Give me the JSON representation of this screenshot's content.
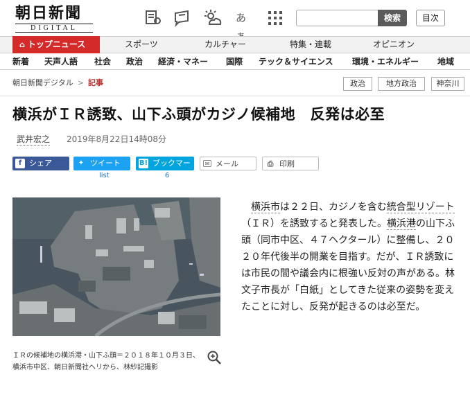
{
  "header": {
    "logo_main": "朝日新聞",
    "logo_sub": "DIGITAL",
    "language_toggle": "あぁ",
    "search_button": "検索",
    "search_placeholder": "",
    "toc_button": "目次"
  },
  "nav_primary": [
    "トップニュース",
    "スポーツ",
    "カルチャー",
    "特集・連載",
    "オピニオン"
  ],
  "nav_secondary": [
    "新着",
    "天声人語",
    "社会",
    "政治",
    "経済・マネー",
    "国際",
    "テック＆サイエンス",
    "環境・エネルギー",
    "地域"
  ],
  "breadcrumb": {
    "home": "朝日新聞デジタル",
    "separator": ">",
    "current": "記事"
  },
  "tags": [
    "政治",
    "地方政治",
    "神奈川"
  ],
  "article": {
    "title": "横浜がＩＲ誘致、山下ふ頭がカジノ候補地　反発は必至",
    "author": "武井宏之",
    "date": "2019年8月22日14時08分",
    "body_parts": [
      {
        "t": "　",
        "link": false
      },
      {
        "t": "横浜市",
        "link": true
      },
      {
        "t": "は２２日、カジノを含む",
        "link": false
      },
      {
        "t": "統合型リゾート",
        "link": true
      },
      {
        "t": "（ＩＲ）を誘致すると発表した。",
        "link": false
      },
      {
        "t": "横浜港",
        "link": true
      },
      {
        "t": "の山下ふ頭（同市中区、４７ヘクタール）に整備し、２０２０年代後半の開業を目指す。だが、ＩＲ誘致には市民の間や議会内に根強い反対の声がある。林文子市長が「白紙」としてきた従来の姿勢を変えたことに対し、反発が起きるのは必至だ。",
        "link": false
      }
    ],
    "photo_caption": "ＩＲの候補地の横浜港・山下ふ頭＝２０１８年１０月３日、横浜市中区、朝日新聞社ヘリから、林紗記撮影"
  },
  "share": {
    "facebook": "シェア",
    "twitter": "ツイート",
    "twitter_count": "list",
    "hatena": "ブックマーク",
    "hatena_count": "6",
    "mail": "メール",
    "print": "印刷"
  },
  "colors": {
    "brand_red": "#d42a2a",
    "facebook": "#3b5998",
    "twitter": "#1da1f2",
    "hatena": "#00a4de"
  }
}
